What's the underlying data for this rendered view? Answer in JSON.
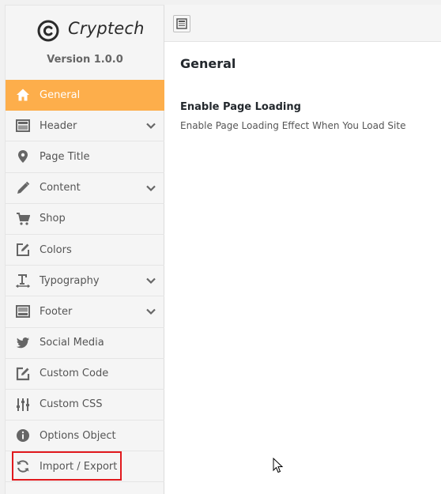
{
  "brand": {
    "name": "Cryptech",
    "version": "Version 1.0.0",
    "logo_icon": "copyright-c-icon"
  },
  "sidebar": {
    "items": [
      {
        "label": "General",
        "icon": "home-icon",
        "active": true,
        "has_children": false
      },
      {
        "label": "Header",
        "icon": "layout-icon",
        "active": false,
        "has_children": true
      },
      {
        "label": "Page Title",
        "icon": "map-pin-icon",
        "active": false,
        "has_children": false
      },
      {
        "label": "Content",
        "icon": "pencil-icon",
        "active": false,
        "has_children": true
      },
      {
        "label": "Shop",
        "icon": "cart-icon",
        "active": false,
        "has_children": false
      },
      {
        "label": "Colors",
        "icon": "edit-square-icon",
        "active": false,
        "has_children": false
      },
      {
        "label": "Typography",
        "icon": "text-height-icon",
        "active": false,
        "has_children": true
      },
      {
        "label": "Footer",
        "icon": "layout-icon",
        "active": false,
        "has_children": true
      },
      {
        "label": "Social Media",
        "icon": "twitter-icon",
        "active": false,
        "has_children": false
      },
      {
        "label": "Custom Code",
        "icon": "edit-square-icon",
        "active": false,
        "has_children": false
      },
      {
        "label": "Custom CSS",
        "icon": "sliders-icon",
        "active": false,
        "has_children": false
      },
      {
        "label": "Options Object",
        "icon": "info-circle-icon",
        "active": false,
        "has_children": false
      },
      {
        "label": "Import / Export",
        "icon": "refresh-icon",
        "active": false,
        "has_children": false,
        "highlighted": true
      }
    ]
  },
  "topbar": {
    "toggle_icon": "panel-toggle-icon"
  },
  "main": {
    "section_title": "General",
    "field_title": "Enable Page Loading",
    "field_desc": "Enable Page Loading Effect When You Load Site"
  },
  "colors": {
    "accent": "#fdae4b",
    "highlight": "#e1191d",
    "icon": "#6b6b6b"
  }
}
